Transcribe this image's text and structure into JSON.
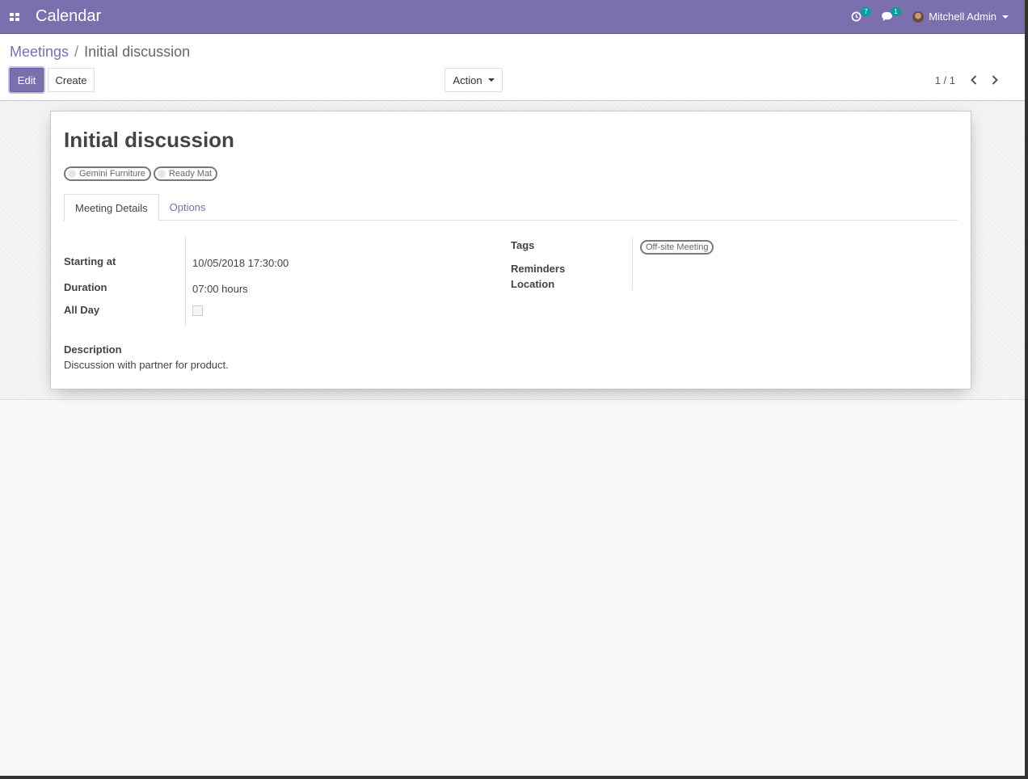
{
  "navbar": {
    "app_title": "Calendar",
    "activity_count": "7",
    "message_count": "1",
    "user_name": "Mitchell Admin"
  },
  "breadcrumb": {
    "parent": "Meetings",
    "separator": "/",
    "current": "Initial discussion"
  },
  "toolbar": {
    "edit_label": "Edit",
    "create_label": "Create",
    "action_label": "Action"
  },
  "pager": {
    "value": "1 / 1"
  },
  "record": {
    "title": "Initial discussion",
    "partners": [
      "Gemini Furniture",
      "Ready Mat"
    ],
    "tabs": [
      "Meeting Details",
      "Options"
    ],
    "active_tab": "Meeting Details",
    "fields": {
      "starting_at": {
        "label": "Starting at",
        "value": "10/05/2018 17:30:00"
      },
      "duration": {
        "label": "Duration",
        "value": "07:00 hours"
      },
      "all_day": {
        "label": "All Day",
        "checked": false
      },
      "tags": {
        "label": "Tags",
        "values": [
          "Off-site Meeting"
        ]
      },
      "reminders": {
        "label": "Reminders",
        "value": ""
      },
      "location": {
        "label": "Location",
        "value": ""
      }
    },
    "description": {
      "label": "Description",
      "value": "Discussion with partner for product."
    }
  },
  "colors": {
    "brand": "#7c6fad",
    "badge": "#00a09d"
  }
}
